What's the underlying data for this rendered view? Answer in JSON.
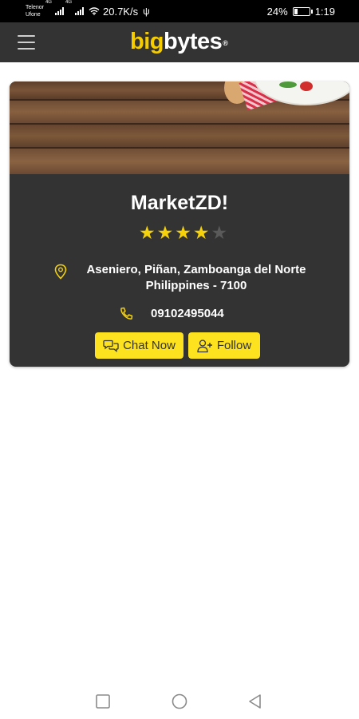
{
  "status_bar": {
    "carrier_1": "Telenor",
    "carrier_2": "Ufone",
    "sig_1_label": "4G",
    "sig_2_label": "4G",
    "speed": "20.7K/s",
    "battery_pct": "24%",
    "battery_level": 0.24,
    "time": "1:19"
  },
  "app_bar": {
    "logo_big": "big",
    "logo_bytes": "bytes",
    "logo_reg": "®"
  },
  "store": {
    "name": "MarketZD!",
    "rating": 4,
    "rating_max": 5,
    "address_line_1": "Aseniero, Piñan, Zamboanga del Norte",
    "address_line_2": "Philippines - 7100",
    "phone": "09102495044"
  },
  "actions": {
    "chat_label": "Chat Now",
    "follow_label": "Follow"
  },
  "colors": {
    "accent": "#fde21f",
    "dark": "#333333",
    "star_on": "#f5d20a",
    "star_off": "#5a5a5a"
  }
}
